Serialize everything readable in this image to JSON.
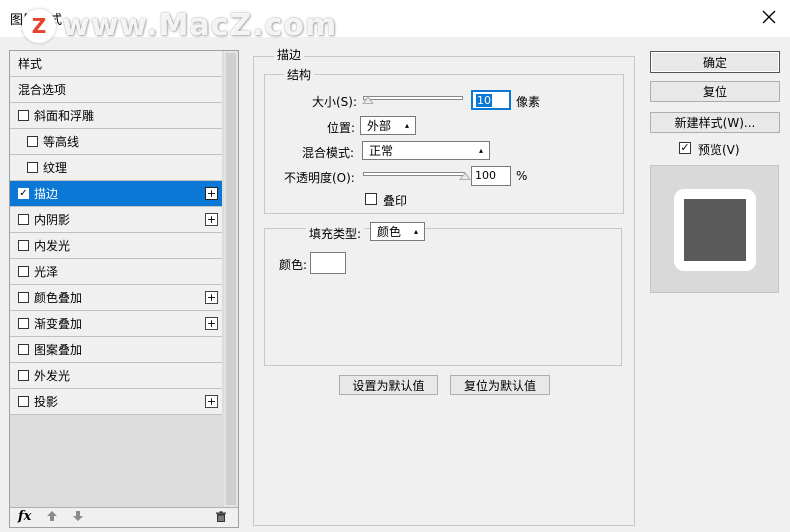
{
  "window": {
    "title": "图层样式",
    "close_icon": "close-icon"
  },
  "watermark": {
    "badge": "Z",
    "text": "www.MacZ.com"
  },
  "sidebar": {
    "items": [
      {
        "label": "样式",
        "type": "header"
      },
      {
        "label": "混合选项",
        "type": "header"
      },
      {
        "label": "斜面和浮雕",
        "checked": false,
        "plus": false
      },
      {
        "label": "等高线",
        "checked": false,
        "plus": false,
        "sub": true
      },
      {
        "label": "纹理",
        "checked": false,
        "plus": false,
        "sub": true
      },
      {
        "label": "描边",
        "checked": true,
        "plus": true,
        "selected": true
      },
      {
        "label": "内阴影",
        "checked": false,
        "plus": true
      },
      {
        "label": "内发光",
        "checked": false,
        "plus": false
      },
      {
        "label": "光泽",
        "checked": false,
        "plus": false
      },
      {
        "label": "颜色叠加",
        "checked": false,
        "plus": true
      },
      {
        "label": "渐变叠加",
        "checked": false,
        "plus": true
      },
      {
        "label": "图案叠加",
        "checked": false,
        "plus": false
      },
      {
        "label": "外发光",
        "checked": false,
        "plus": false
      },
      {
        "label": "投影",
        "checked": false,
        "plus": true
      }
    ],
    "footer": {
      "fx_label": "fx",
      "up_icon": "arrow-up-icon",
      "down_icon": "arrow-down-icon",
      "trash_icon": "trash-icon"
    }
  },
  "stroke": {
    "section_title": "描边",
    "structure_title": "结构",
    "size_label": "大小(S):",
    "size_value": "10",
    "size_unit": "像素",
    "position_label": "位置:",
    "position_value": "外部",
    "blend_label": "混合模式:",
    "blend_value": "正常",
    "opacity_label": "不透明度(O):",
    "opacity_value": "100",
    "opacity_unit": "%",
    "opacity_level": 1.0,
    "size_level": 0.05,
    "overprint_label": "叠印",
    "overprint_checked": false,
    "fill_type_label": "填充类型:",
    "fill_type_value": "颜色",
    "color_label": "颜色:",
    "color_value": "#ffffff",
    "set_default_label": "设置为默认值",
    "reset_default_label": "复位为默认值"
  },
  "actions": {
    "ok_label": "确定",
    "reset_label": "复位",
    "new_style_label": "新建样式(W)...",
    "preview_label": "预览(V)",
    "preview_checked": true
  },
  "colors": {
    "accent": "#0c78d6",
    "preview_fill": "#5a5a5a",
    "preview_stroke": "#ffffff"
  }
}
